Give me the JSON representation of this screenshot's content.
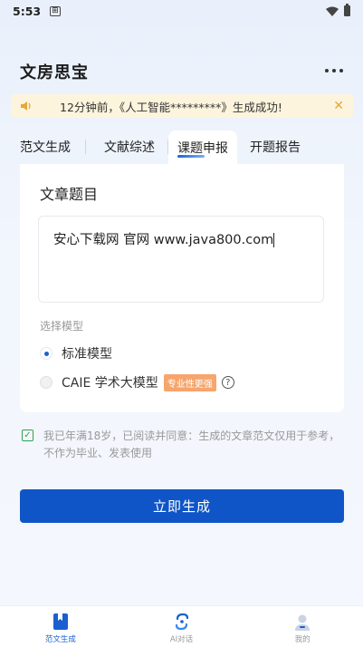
{
  "status": {
    "time": "5:53",
    "extra": "⊞"
  },
  "app": {
    "title": "文房思宝"
  },
  "notice": {
    "text": "12分钟前，《人工智能*********》生成成功!"
  },
  "tabs": [
    {
      "label": "范文生成"
    },
    {
      "label": "文献综述"
    },
    {
      "label": "课题申报"
    },
    {
      "label": "开题报告"
    }
  ],
  "form": {
    "title_label": "文章题目",
    "title_value": "安心下载网  官网 www.java800.com",
    "model_label": "选择模型",
    "models": [
      {
        "label": "标准模型",
        "checked": true
      },
      {
        "label": "CAIE 学术大模型",
        "badge": "专业性更强",
        "checked": false
      }
    ]
  },
  "agreement": {
    "text": "我已年满18岁，已阅读并同意：生成的文章范文仅用于参考，不作为毕业、发表使用",
    "checked": true
  },
  "submit_label": "立即生成",
  "nav": [
    {
      "label": "范文生成",
      "icon": "book-icon",
      "active": true
    },
    {
      "label": "AI对话",
      "icon": "ai-chat-icon",
      "active": false
    },
    {
      "label": "我的",
      "icon": "profile-icon",
      "active": false
    }
  ],
  "colors": {
    "primary": "#0f55c8",
    "accent_orange": "#f6a56d",
    "notice_bg": "#fcf4dc",
    "check_green": "#2ea44f"
  }
}
